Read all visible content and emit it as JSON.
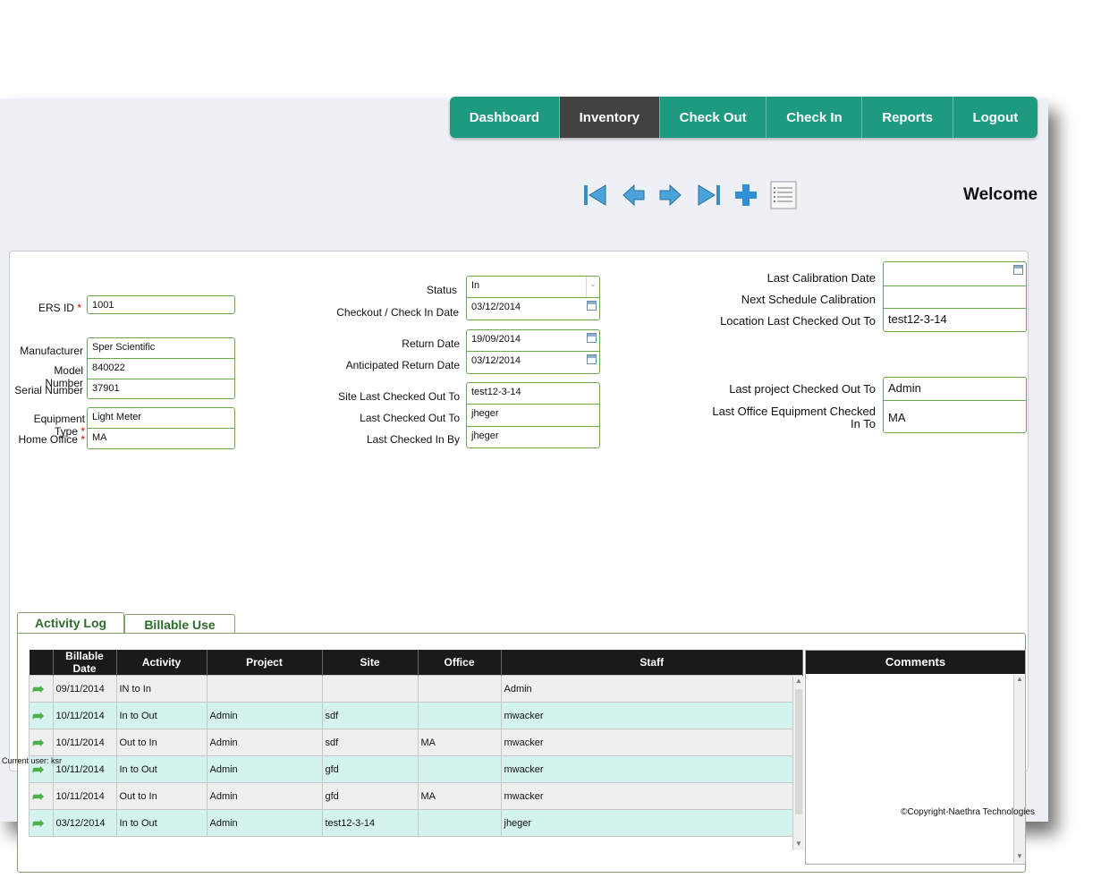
{
  "nav": {
    "tabs": [
      {
        "label": "Dashboard"
      },
      {
        "label": "Inventory"
      },
      {
        "label": "Check Out"
      },
      {
        "label": "Check In"
      },
      {
        "label": "Reports"
      },
      {
        "label": "Logout"
      }
    ],
    "active": "Inventory"
  },
  "toolbar": {
    "icons": [
      "first-record-icon",
      "previous-record-icon",
      "next-record-icon",
      "last-record-icon",
      "add-icon",
      "list-icon"
    ],
    "accent": "#3a8fc7"
  },
  "header": {
    "welcome": "Welcome"
  },
  "form": {
    "ers_id_label": "ERS ID",
    "ers_id": "1001",
    "manufacturer_label": "Manufacturer",
    "manufacturer": "Sper Scientific",
    "model_number_label": "Model Number",
    "model_number": "840022",
    "serial_number_label": "Serial Number",
    "serial_number": "37901",
    "equipment_type_label": "Equipment Type",
    "equipment_type": "Light Meter",
    "home_office_label": "Home Office",
    "home_office": "MA",
    "required_mark": "*",
    "status_label": "Status",
    "status": "In",
    "checkout_checkin_label": "Checkout / Check In Date",
    "checkout_checkin_date": "03/12/2014",
    "return_date_label": "Return Date",
    "return_date": "19/09/2014",
    "anticipated_return_label": "Anticipated Return Date",
    "anticipated_return_date": "03/12/2014",
    "site_last_label": "Site Last Checked Out To",
    "site_last": "test12-3-14",
    "last_checked_out_label": "Last Checked Out To",
    "last_checked_out": "jheger",
    "last_checked_in_label": "Last Checked In By",
    "last_checked_in": "jheger",
    "last_calibration_label": "Last Calibration Date",
    "last_calibration": "",
    "next_calibration_label": "Next Schedule Calibration",
    "next_calibration": "",
    "location_last_label": "Location Last Checked Out To",
    "location_last": "test12-3-14",
    "last_project_label": "Last project Checked Out To",
    "last_project": "Admin",
    "last_office_label_1": "Last Office Equipment Checked",
    "last_office_label_2": "In To",
    "last_office": "MA"
  },
  "tabs": {
    "activity": "Activity Log",
    "billable": "Billable Use Log"
  },
  "table": {
    "columns": [
      "",
      "Billable Date",
      "Activity",
      "Project",
      "Site",
      "Office",
      "Staff"
    ],
    "rows": [
      [
        "09/11/2014",
        "IN to In",
        "",
        "",
        "",
        "Admin"
      ],
      [
        "10/11/2014",
        "In to Out",
        "Admin",
        "sdf",
        "",
        "mwacker"
      ],
      [
        "10/11/2014",
        "Out to In",
        "Admin",
        "sdf",
        "MA",
        "mwacker"
      ],
      [
        "10/11/2014",
        "In to Out",
        "Admin",
        "gfd",
        "",
        "mwacker"
      ],
      [
        "10/11/2014",
        "Out to In",
        "Admin",
        "gfd",
        "MA",
        "mwacker"
      ],
      [
        "03/12/2014",
        "In to Out",
        "Admin",
        "test12-3-14",
        "",
        "jheger"
      ]
    ],
    "comments_header": "Comments"
  },
  "footer": {
    "current_user": "Current user: ksr",
    "copyright": "©Copyright-Naethra Technologies"
  }
}
